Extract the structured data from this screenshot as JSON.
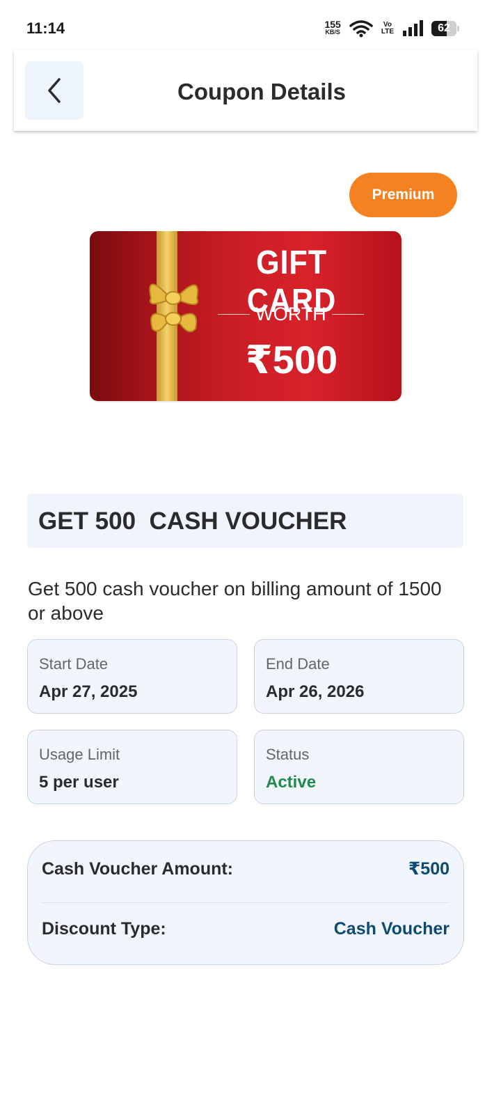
{
  "status_bar": {
    "time": "11:14",
    "net_speed_value": "155",
    "net_speed_unit": "KB/S",
    "volte_top": "Vo",
    "volte_bottom": "LTE",
    "battery_level": "62"
  },
  "header": {
    "title": "Coupon Details",
    "back_icon": "chevron-left-icon"
  },
  "badge": {
    "label": "Premium",
    "color": "#f58220"
  },
  "gift_card_image": {
    "title": "GIFT CARD",
    "worth": "WORTH",
    "amount": "₹500"
  },
  "coupon": {
    "title": "GET 500  CASH VOUCHER",
    "description": "Get 500 cash voucher on billing amount of 1500 or above"
  },
  "info": [
    {
      "label": "Start Date",
      "value": "Apr 27, 2025"
    },
    {
      "label": "End Date",
      "value": "Apr 26, 2026"
    },
    {
      "label": "Usage Limit",
      "value": "5 per user"
    },
    {
      "label": "Status",
      "value": "Active"
    }
  ],
  "summary": {
    "amount_label": "Cash Voucher Amount:",
    "amount_value": "₹500",
    "type_label": "Discount Type:",
    "type_value": "Cash Voucher"
  },
  "colors": {
    "accent": "#f58220",
    "status_active": "#1f8a4c",
    "value_blue": "#0d4a72",
    "card_bg": "#f1f6fc"
  }
}
